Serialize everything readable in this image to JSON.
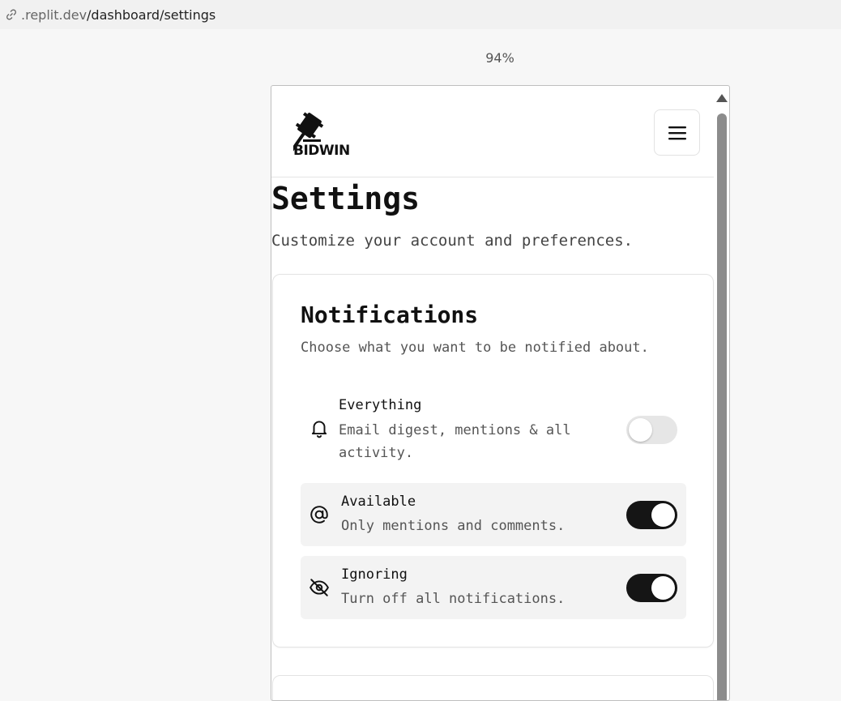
{
  "browser": {
    "url_domain": ".replit.dev",
    "url_path": "/dashboard/settings",
    "zoom": "94%"
  },
  "header": {
    "logo_text": "BIDWIN",
    "menu_icon": "hamburger-icon"
  },
  "page": {
    "title": "Settings",
    "subtitle": "Customize your account and preferences."
  },
  "notifications": {
    "title": "Notifications",
    "description": "Choose what you want to be notified about.",
    "options": [
      {
        "icon": "bell-icon",
        "label": "Everything",
        "description": "Email digest, mentions & all activity.",
        "enabled": false
      },
      {
        "icon": "at-sign-icon",
        "label": "Available",
        "description": "Only mentions and comments.",
        "enabled": true
      },
      {
        "icon": "eye-off-icon",
        "label": "Ignoring",
        "description": "Turn off all notifications.",
        "enabled": true
      }
    ]
  },
  "colors": {
    "toggle_on": "#151515",
    "toggle_off": "#e6e6e6",
    "active_row": "#f3f3f3"
  }
}
